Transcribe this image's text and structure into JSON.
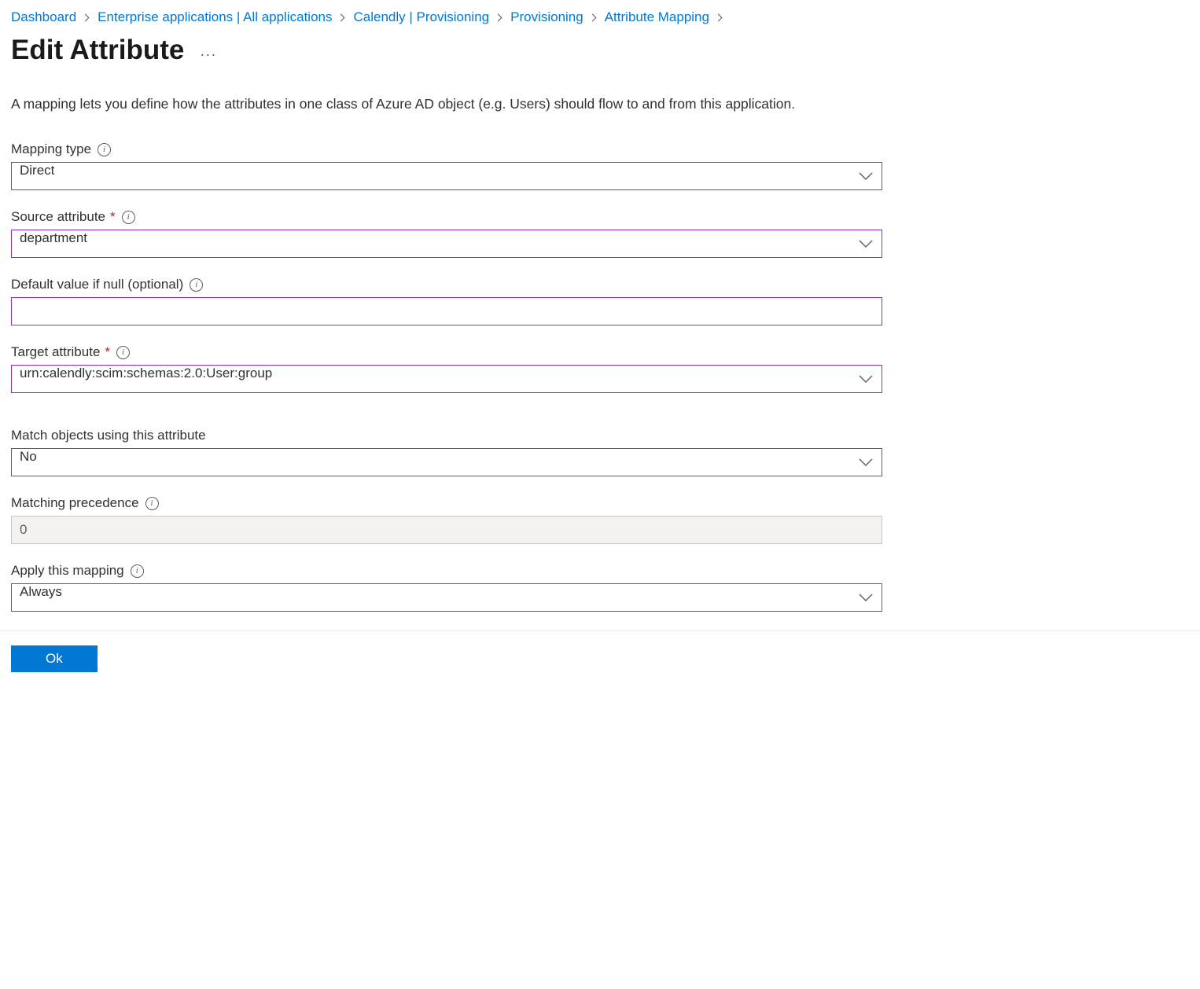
{
  "breadcrumb": {
    "items": [
      {
        "label": "Dashboard"
      },
      {
        "label": "Enterprise applications | All applications"
      },
      {
        "label": "Calendly | Provisioning"
      },
      {
        "label": "Provisioning"
      },
      {
        "label": "Attribute Mapping"
      }
    ]
  },
  "header": {
    "title": "Edit Attribute"
  },
  "description": "A mapping lets you define how the attributes in one class of Azure AD object (e.g. Users) should flow to and from this application.",
  "form": {
    "mapping_type": {
      "label": "Mapping type",
      "value": "Direct"
    },
    "source_attribute": {
      "label": "Source attribute",
      "value": "department"
    },
    "default_value": {
      "label": "Default value if null (optional)",
      "value": ""
    },
    "target_attribute": {
      "label": "Target attribute",
      "value": "urn:calendly:scim:schemas:2.0:User:group"
    },
    "match_objects": {
      "label": "Match objects using this attribute",
      "value": "No"
    },
    "matching_precedence": {
      "label": "Matching precedence",
      "value": "0"
    },
    "apply_mapping": {
      "label": "Apply this mapping",
      "value": "Always"
    }
  },
  "buttons": {
    "ok": "Ok"
  }
}
